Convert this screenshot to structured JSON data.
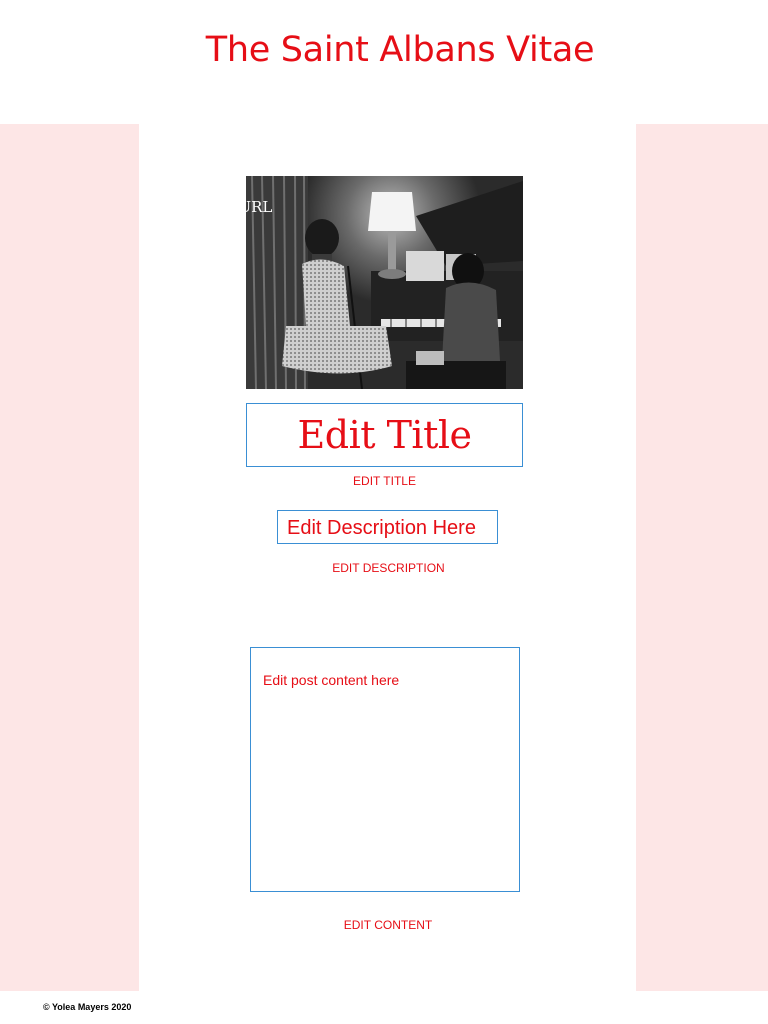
{
  "header": {
    "site_title": "The Saint Albans Vitae"
  },
  "colors": {
    "accent": "#e60e16",
    "side_panel": "#fde6e6",
    "field_border": "#3a8fd4"
  },
  "post": {
    "image_alt": "Black and white photo of a woman seated beside a grand piano with a pianist",
    "edit_image_url_label": "Edit Image URL",
    "title_value": "Edit Title",
    "edit_title_label": "EDIT TITLE",
    "description_value": "Edit Description Here",
    "edit_description_label": "EDIT DESCRIPTION",
    "content_value": "Edit post content here",
    "edit_content_label": "EDIT CONTENT"
  },
  "footer": {
    "copyright": "© Yolea Mayers 2020"
  }
}
